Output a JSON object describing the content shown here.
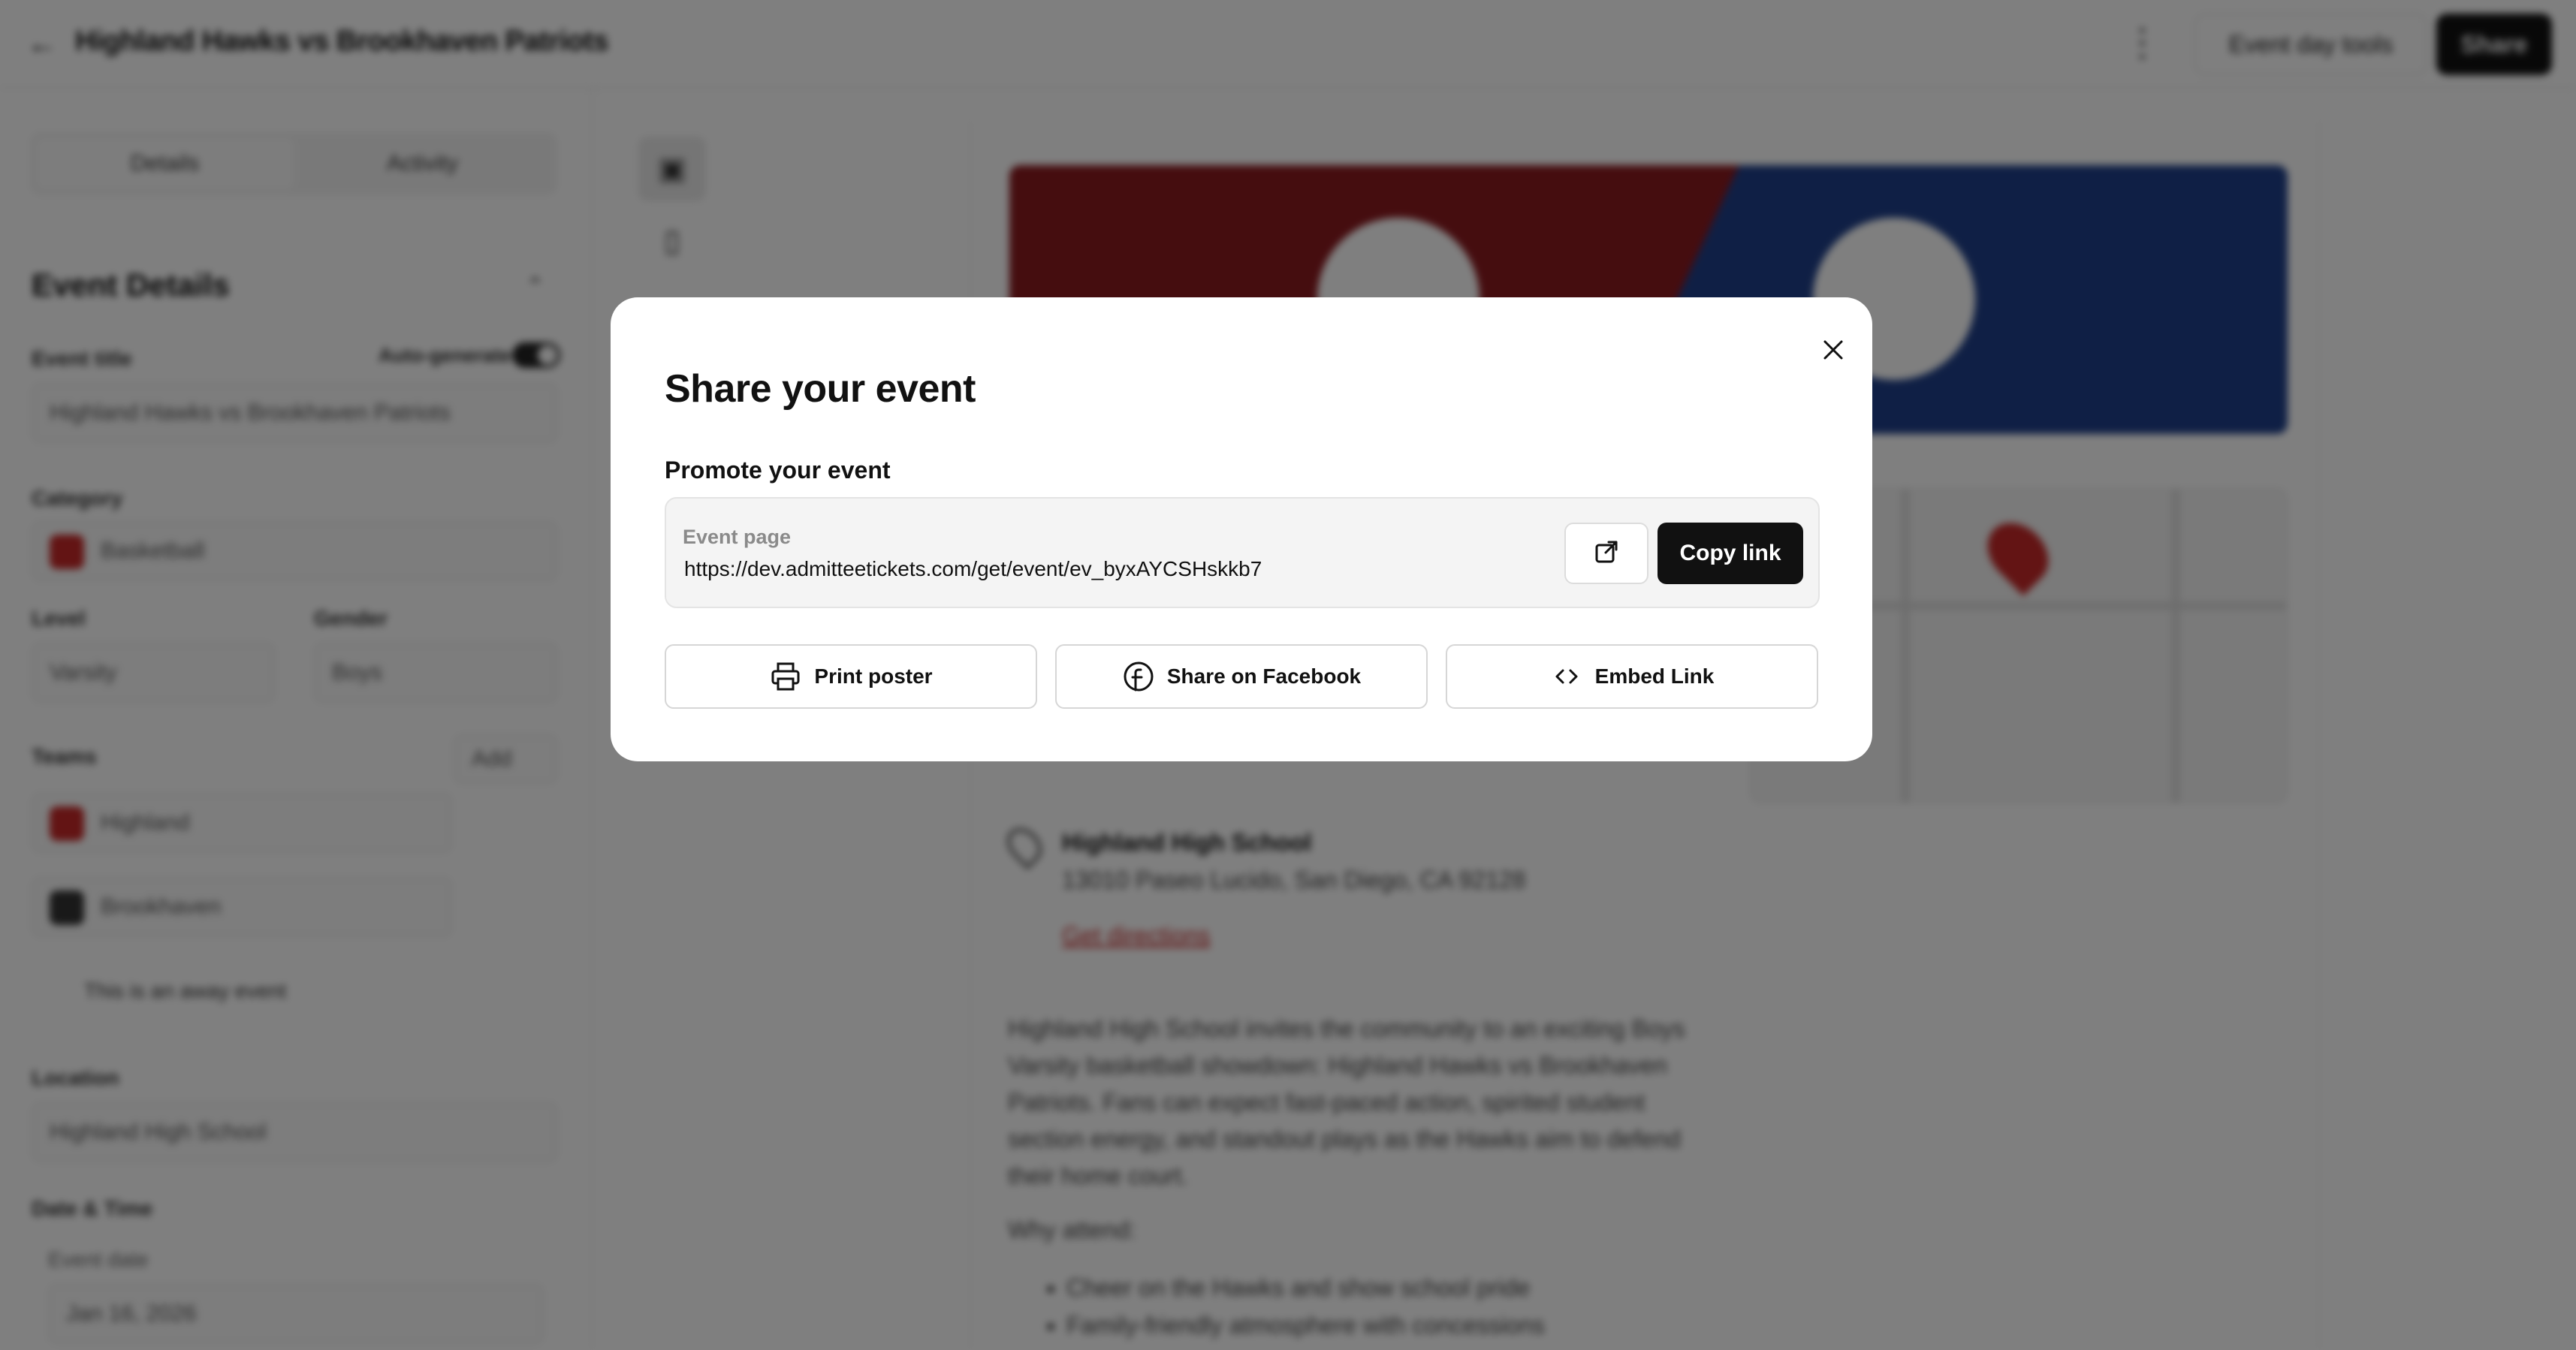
{
  "header": {
    "title": "Highland Hawks vs Brookhaven Patriots",
    "tools_label": "Event day tools",
    "share_label": "Share"
  },
  "sidebar": {
    "tabs": [
      "Details",
      "Activity"
    ],
    "section_title": "Event Details",
    "event_title_label": "Event title",
    "auto_generate_label": "Auto-generate",
    "event_title_value": "Highland Hawks vs Brookhaven Patriots",
    "category_label": "Category",
    "category_value": "Basketball",
    "level_label": "Level",
    "level_value": "Varsity",
    "gender_label": "Gender",
    "gender_value": "Boys",
    "teams_label": "Teams",
    "add_label": "Add",
    "team_1": "Highland",
    "team_2": "Brookhaven",
    "away_label": "This is an away event",
    "location_label": "Location",
    "location_value": "Highland High School",
    "datetime_label": "Date & Time",
    "event_date_label": "Event date",
    "event_date_value": "Jan 16, 2026"
  },
  "preview": {
    "venue_name": "Highland High School",
    "venue_address": "13010 Paseo Lucido, San Diego, CA 92128",
    "directions_label": "Get directions",
    "description": "Highland High School invites the community to an exciting Boys Varsity basketball showdown: Highland Hawks vs Brookhaven Patriots. Fans can expect fast-paced action, spirited student section energy, and standout plays as the Hawks aim to defend their home court.",
    "why_label": "Why attend:",
    "bullets": [
      "Cheer on the Hawks and show school pride",
      "Family-friendly atmosphere with concessions"
    ]
  },
  "modal": {
    "title": "Share your event",
    "promote_label": "Promote your event",
    "event_page_label": "Event page",
    "event_url": "https://dev.admitteetickets.com/get/event/ev_byxAYCSHskkb7",
    "copy_label": "Copy link",
    "print_label": "Print poster",
    "facebook_label": "Share on Facebook",
    "embed_label": "Embed Link"
  },
  "colors": {
    "primary": "#111111",
    "home_team": "#8b1a1f",
    "away_team": "#1f3f8a",
    "accent_red": "#c62828"
  }
}
